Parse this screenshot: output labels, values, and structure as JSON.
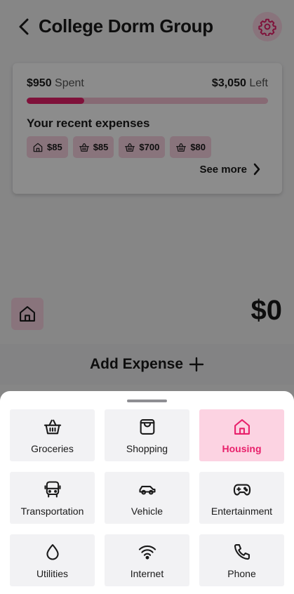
{
  "header": {
    "title": "College Dorm Group"
  },
  "budget": {
    "spent_amount": "$950",
    "spent_label": "Spent",
    "left_amount": "$3,050",
    "left_label": "Left",
    "spent_fraction": 0.2375
  },
  "recent": {
    "title": "Your recent expenses",
    "items": [
      {
        "icon": "house-icon",
        "amount": "$85"
      },
      {
        "icon": "basket-icon",
        "amount": "$85"
      },
      {
        "icon": "basket-icon",
        "amount": "$700"
      },
      {
        "icon": "basket-icon",
        "amount": "$80"
      }
    ],
    "see_more": "See more"
  },
  "expense": {
    "amount": "$0",
    "category_icon": "house-icon"
  },
  "add_expense": {
    "label": "Add Expense"
  },
  "categories": [
    {
      "label": "Groceries",
      "icon": "basket-icon"
    },
    {
      "label": "Shopping",
      "icon": "shopping-bag-icon"
    },
    {
      "label": "Housing",
      "icon": "house-icon",
      "selected": true
    },
    {
      "label": "Transportation",
      "icon": "bus-icon"
    },
    {
      "label": "Vehicle",
      "icon": "car-icon"
    },
    {
      "label": "Entertainment",
      "icon": "gamepad-icon"
    },
    {
      "label": "Utilities",
      "icon": "drop-icon"
    },
    {
      "label": "Internet",
      "icon": "wifi-icon"
    },
    {
      "label": "Phone",
      "icon": "phone-icon"
    }
  ],
  "colors": {
    "accent": "#e8206b",
    "accent_light": "#f9d3e2",
    "tile_bg": "#f2f2f4"
  }
}
